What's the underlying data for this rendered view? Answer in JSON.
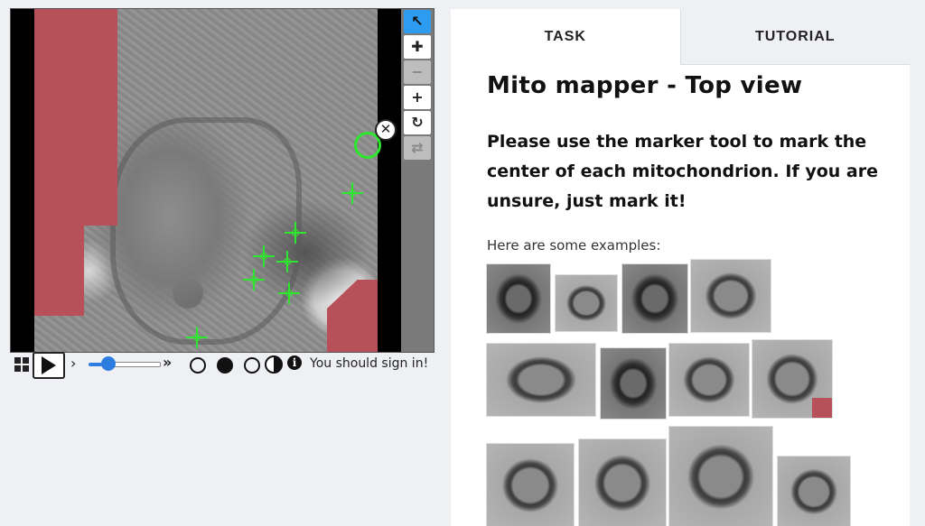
{
  "viewer": {
    "tools": [
      {
        "name": "select",
        "glyph": "↖",
        "state": "active"
      },
      {
        "name": "pan",
        "glyph": "✚",
        "state": "normal"
      },
      {
        "name": "zoom-out",
        "glyph": "−",
        "state": "disabled"
      },
      {
        "name": "zoom-in",
        "glyph": "+",
        "state": "normal"
      },
      {
        "name": "rotate",
        "glyph": "↻",
        "state": "normal"
      },
      {
        "name": "reset",
        "glyph": "⇄",
        "state": "disabled"
      }
    ],
    "close_glyph": "✕",
    "marker_color": "#2ee62e",
    "mask_color": "#b8505a"
  },
  "playbar": {
    "chevron_left": "›",
    "chevron_right": "»",
    "info_glyph": "i",
    "signin_text": "You should sign in!"
  },
  "panel": {
    "tabs": [
      {
        "label": "TASK",
        "active": true
      },
      {
        "label": "TUTORIAL",
        "active": false
      }
    ],
    "title": "Mito mapper - Top view",
    "instructions": "Please use the marker tool to mark the center of each mitochondrion. If you are unsure, just mark it!",
    "examples_label": "Here are some examples:"
  },
  "colors": {
    "accent": "#2d9bf0",
    "slider": "#2d7de0",
    "background": "#eef0f4"
  }
}
